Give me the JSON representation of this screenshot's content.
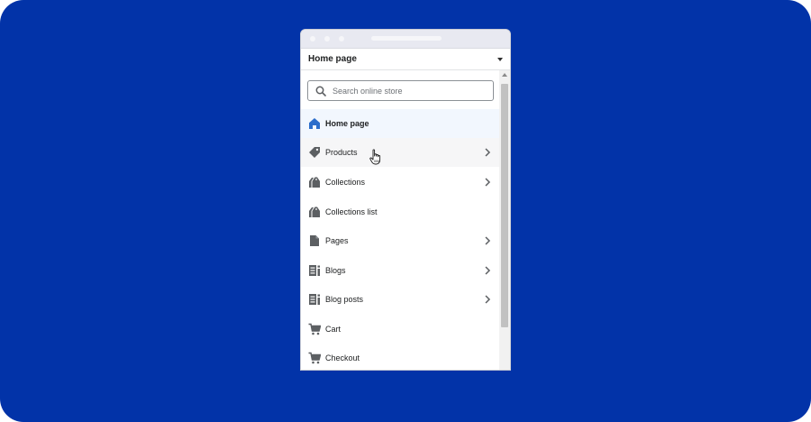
{
  "colors": {
    "background": "#0233a8",
    "selected_icon": "#2c6ecb",
    "icon": "#5c5f62"
  },
  "header": {
    "title": "Home page"
  },
  "search": {
    "placeholder": "Search online store"
  },
  "menu": {
    "items": [
      {
        "label": "Home page",
        "icon": "home-icon",
        "has_submenu": false,
        "selected": true
      },
      {
        "label": "Products",
        "icon": "tag-icon",
        "has_submenu": true,
        "hovered": true
      },
      {
        "label": "Collections",
        "icon": "collections-icon",
        "has_submenu": true
      },
      {
        "label": "Collections list",
        "icon": "collections-icon",
        "has_submenu": false
      },
      {
        "label": "Pages",
        "icon": "page-icon",
        "has_submenu": true
      },
      {
        "label": "Blogs",
        "icon": "blog-icon",
        "has_submenu": true
      },
      {
        "label": "Blog posts",
        "icon": "blog-icon",
        "has_submenu": true
      },
      {
        "label": "Cart",
        "icon": "cart-icon",
        "has_submenu": false
      },
      {
        "label": "Checkout",
        "icon": "cart-icon",
        "has_submenu": false
      }
    ]
  }
}
